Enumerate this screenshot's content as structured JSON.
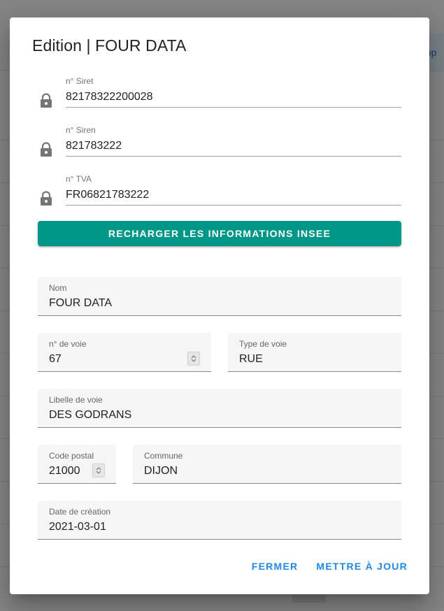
{
  "dialog": {
    "title": "Edition | FOUR DATA"
  },
  "locked_fields": {
    "siret": {
      "label": "n° Siret",
      "value": "82178322200028"
    },
    "siren": {
      "label": "n° Siren",
      "value": "821783222"
    },
    "tva": {
      "label": "n° TVA",
      "value": "FR06821783222"
    }
  },
  "reload_button": {
    "label": "RECHARGER LES INFORMATIONS INSEE"
  },
  "form": {
    "nom": {
      "label": "Nom",
      "value": "FOUR DATA"
    },
    "numero_voie": {
      "label": "n° de voie",
      "value": "67"
    },
    "type_voie": {
      "label": "Type de voie",
      "value": "RUE"
    },
    "libelle_voie": {
      "label": "Libelle de voie",
      "value": "DES GODRANS"
    },
    "code_postal": {
      "label": "Code postal",
      "value": "21000"
    },
    "commune": {
      "label": "Commune",
      "value": "DIJON"
    },
    "date_creation": {
      "label": "Date de création",
      "value": "2021-03-01"
    }
  },
  "actions": {
    "close_label": "FERMER",
    "update_label": "METTRE À JOUR"
  },
  "background": {
    "button_partial": "app"
  },
  "colors": {
    "primary": "#009688",
    "action": "#1e88e5"
  },
  "icons": [
    "lock-icon",
    "stepper-icon"
  ]
}
